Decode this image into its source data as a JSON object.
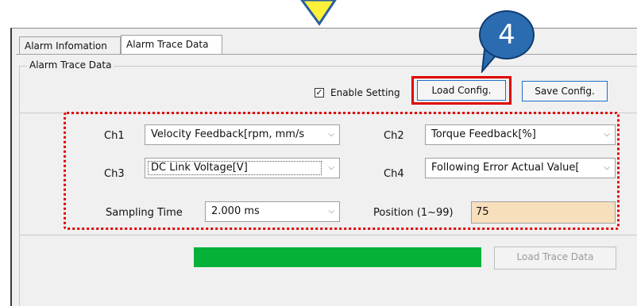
{
  "tabs": [
    {
      "label": "Alarm Infomation"
    },
    {
      "label": "Alarm Trace Data"
    }
  ],
  "group_title": "Alarm Trace Data",
  "enable_setting": {
    "label": "Enable Setting",
    "checked_glyph": "✓"
  },
  "buttons": {
    "load_config": "Load Config.",
    "save_config": "Save Config.",
    "load_trace_data": "Load Trace Data"
  },
  "callout": {
    "number": "4"
  },
  "channels": {
    "ch1": {
      "label": "Ch1",
      "value": "Velocity Feedback[rpm, mm/s"
    },
    "ch2": {
      "label": "Ch2",
      "value": "Torque Feedback[%]"
    },
    "ch3": {
      "label": "Ch3",
      "value": "DC Link Voltage[V]"
    },
    "ch4": {
      "label": "Ch4",
      "value": "Following Error Actual Value["
    }
  },
  "sampling_time": {
    "label": "Sampling Time",
    "value": "2.000 ms"
  },
  "position": {
    "label": "Position (1~99)",
    "value": "75"
  },
  "progress": {
    "fraction": 1.0
  },
  "icons": {
    "dropdown": "chevron-down-icon",
    "pointer": "down-arrow-icon"
  },
  "colors": {
    "highlight": "#e00000",
    "callout": "#2b6cb0",
    "progress": "#06b13a",
    "position_bg": "#f8dfbc",
    "arrow": "#fff03a"
  }
}
